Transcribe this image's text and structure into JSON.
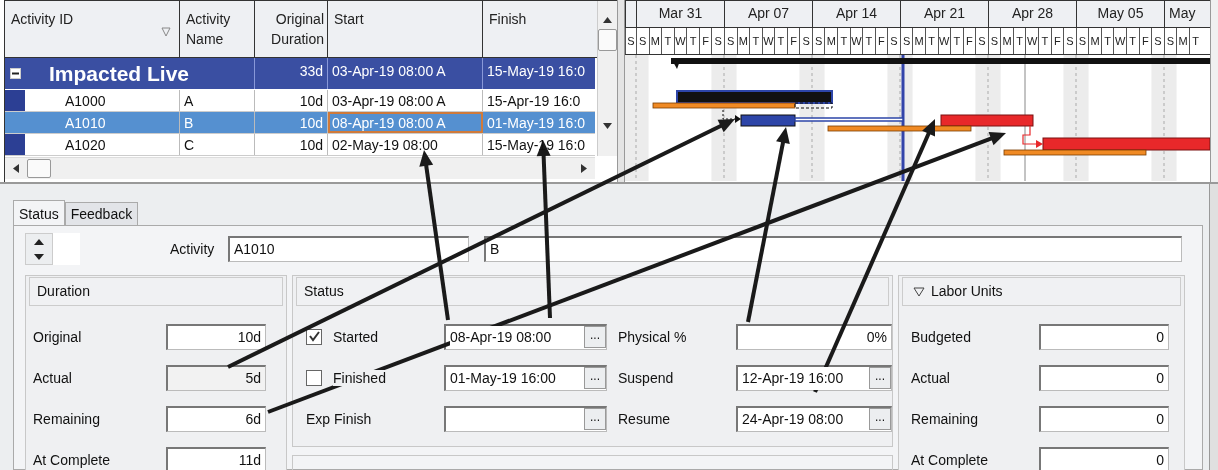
{
  "table": {
    "columns": [
      "Activity ID",
      "Activity Name",
      "Original Duration",
      "Start",
      "Finish"
    ],
    "rows": [
      {
        "kind": "group",
        "expanded": true,
        "activity_id": "Impacted Live",
        "original_duration": "33d",
        "start": "03-Apr-19 08:00 A",
        "finish": "15-May-19 16:0"
      },
      {
        "kind": "activity",
        "selected": false,
        "activity_id": "A1000",
        "activity_name": "A",
        "original_duration": "10d",
        "start": "03-Apr-19 08:00 A",
        "finish": "15-Apr-19 16:0"
      },
      {
        "kind": "activity",
        "selected": true,
        "activity_id": "A1010",
        "activity_name": "B",
        "original_duration": "10d",
        "start": "08-Apr-19 08:00 A",
        "finish": "01-May-19 16:0"
      },
      {
        "kind": "activity",
        "selected": false,
        "activity_id": "A1020",
        "activity_name": "C",
        "original_duration": "10d",
        "start": "02-May-19 08:00",
        "finish": "15-May-19 16:0"
      }
    ]
  },
  "gantt": {
    "months": [
      "Mar 31",
      "Apr 07",
      "Apr 14",
      "Apr 21",
      "Apr 28",
      "May 05",
      "May"
    ],
    "days": [
      "S",
      "S",
      "M",
      "T",
      "W",
      "T",
      "F",
      "S",
      "S",
      "M",
      "T",
      "W",
      "T",
      "F",
      "S",
      "S",
      "M",
      "T",
      "W",
      "T",
      "F",
      "S",
      "S",
      "M",
      "T",
      "W",
      "T",
      "F",
      "S",
      "S",
      "M",
      "T",
      "W",
      "T",
      "F",
      "S",
      "S",
      "M",
      "T",
      "W",
      "T",
      "F",
      "S",
      "S",
      "M",
      "T"
    ]
  },
  "details": {
    "tabs": [
      {
        "label": "Status",
        "selected": true
      },
      {
        "label": "Feedback",
        "selected": false
      }
    ],
    "activity_label": "Activity",
    "activity_id": "A1010",
    "activity_name": "B",
    "duration": {
      "title": "Duration",
      "fields": [
        {
          "label": "Original",
          "value": "10d",
          "editable": true
        },
        {
          "label": "Actual",
          "value": "5d",
          "editable": false
        },
        {
          "label": "Remaining",
          "value": "6d",
          "editable": true
        },
        {
          "label": "At Complete",
          "value": "11d",
          "editable": true
        }
      ]
    },
    "status": {
      "title": "Status",
      "left": [
        {
          "kind": "checkbox",
          "label": "Started",
          "checked": true,
          "value": "08-Apr-19 08:00",
          "picker": "..."
        },
        {
          "kind": "checkbox",
          "label": "Finished",
          "checked": false,
          "value": "01-May-19 16:00",
          "picker": "..."
        },
        {
          "kind": "plain",
          "label": "Exp Finish",
          "picker": "..."
        }
      ],
      "right": [
        {
          "label": "Physical %",
          "value": "0%"
        },
        {
          "label": "Suspend",
          "value": "12-Apr-19 16:00",
          "picker": "..."
        },
        {
          "label": "Resume",
          "value": "24-Apr-19 08:00",
          "picker": "..."
        }
      ]
    },
    "labor_units": {
      "title": "Labor Units",
      "expanded": true,
      "fields": [
        {
          "label": "Budgeted",
          "value": "0"
        },
        {
          "label": "Actual",
          "value": "0"
        },
        {
          "label": "Remaining",
          "value": "0"
        },
        {
          "label": "At Complete",
          "value": "0"
        }
      ]
    }
  }
}
